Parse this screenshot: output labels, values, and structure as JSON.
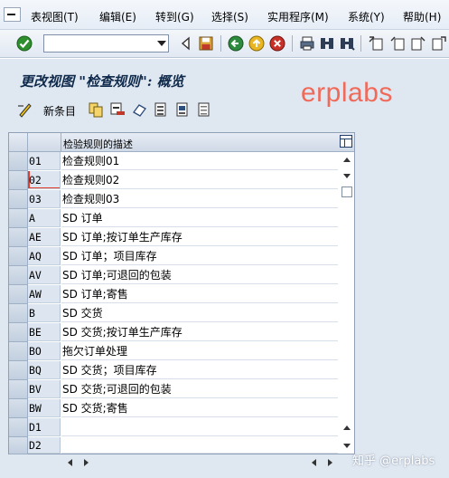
{
  "menubar": {
    "items": [
      {
        "label": "表视图(T)"
      },
      {
        "label": "编辑(E)"
      },
      {
        "label": "转到(G)"
      },
      {
        "label": "选择(S)"
      },
      {
        "label": "实用程序(M)"
      },
      {
        "label": "系统(Y)"
      },
      {
        "label": "帮助(H)"
      }
    ]
  },
  "toolbar": {
    "command_field": {
      "value": "",
      "placeholder": ""
    },
    "icons": [
      "enter-icon",
      "back-icon",
      "save-icon",
      "back-nav-icon",
      "exit-icon",
      "cancel-icon",
      "print-icon",
      "find-icon",
      "find-next-icon",
      "first-page-icon",
      "prev-page-icon",
      "next-page-icon",
      "last-page-icon"
    ]
  },
  "title": {
    "text": "更改视图 \"检查规则\": 概览"
  },
  "watermark": {
    "brand": "erplabs",
    "source": "知乎 @erplabs"
  },
  "app_toolbar": {
    "new_entries_label": "新条目",
    "icons": [
      "new-entries-icon",
      "copy-icon",
      "delete-icon",
      "undo-icon",
      "select-all-icon",
      "select-block-icon",
      "deselect-all-icon"
    ]
  },
  "table": {
    "header": {
      "description": "检验规则的描述"
    },
    "rows": [
      {
        "key": "01",
        "description": "检查规则01"
      },
      {
        "key": "02",
        "description": "检查规则02",
        "focused": true
      },
      {
        "key": "03",
        "description": "检查规则03"
      },
      {
        "key": "A",
        "description": "SD 订单"
      },
      {
        "key": "AE",
        "description": "SD 订单;按订单生产库存"
      },
      {
        "key": "AQ",
        "description": "SD 订单；项目库存"
      },
      {
        "key": "AV",
        "description": "SD 订单;可退回的包装"
      },
      {
        "key": "AW",
        "description": "SD 订单;寄售"
      },
      {
        "key": "B",
        "description": "SD 交货"
      },
      {
        "key": "BE",
        "description": "SD 交货;按订单生产库存"
      },
      {
        "key": "BO",
        "description": "拖欠订单处理"
      },
      {
        "key": "BQ",
        "description": "SD 交货；项目库存"
      },
      {
        "key": "BV",
        "description": "SD 交货;可退回的包装"
      },
      {
        "key": "BW",
        "description": "SD 交货;寄售"
      },
      {
        "key": "D1",
        "description": ""
      },
      {
        "key": "D2",
        "description": ""
      }
    ]
  },
  "colors": {
    "background": "#dfe7f1",
    "brand_watermark": "#f06a5a",
    "key_column": "#dde6f0",
    "focus": "#e23c2c"
  }
}
